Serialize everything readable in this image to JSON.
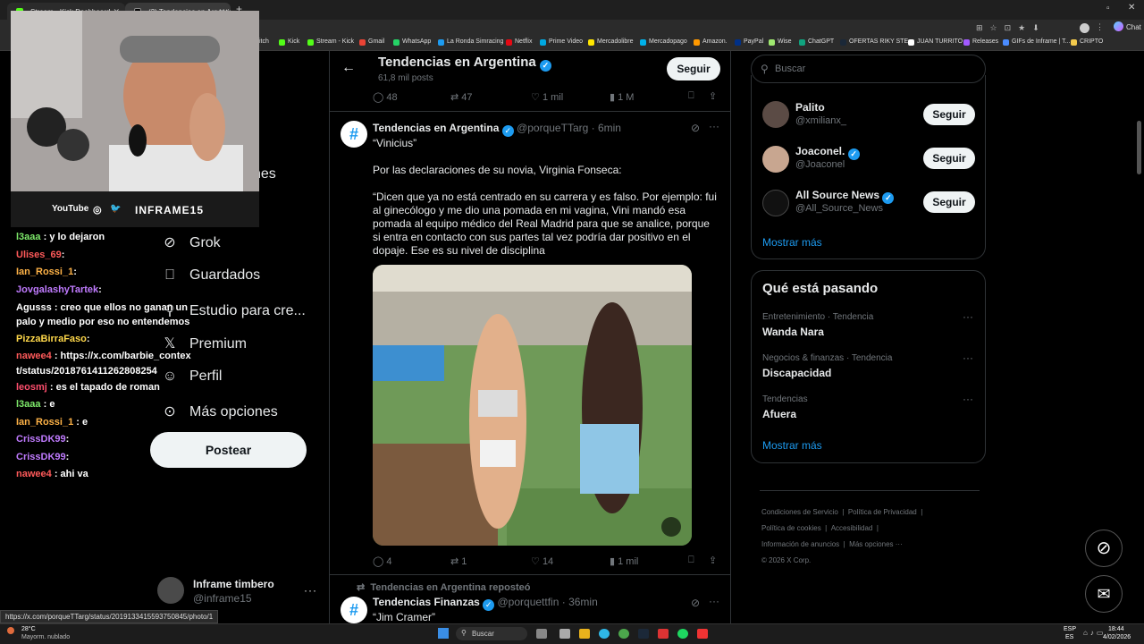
{
  "browser": {
    "tabs": [
      {
        "title": "Stream - Kick Dashboard"
      },
      {
        "title": "(2) Tendencias en Argentina (@po..."
      }
    ],
    "bookmarks": [
      "itch",
      "Kick",
      "Stream - Kick",
      "Gmail",
      "WhatsApp",
      "La Ronda Simracing",
      "Netflix",
      "Prime Video",
      "Mercadolibre",
      "Mercadopago",
      "Amazon.",
      "PayPal",
      "Wise",
      "ChatGPT",
      "OFERTAS RIKY STE...",
      "JUAN TURRITO",
      "Releases",
      "GIFs de Inframe | T...",
      "CRIPTO"
    ],
    "chat_btn": "Chat",
    "status_url": "https://x.com/porqueTTarg/status/2019133415593750845/photo/1"
  },
  "stream": {
    "social_youtube": "YouTube",
    "social_handle": "INFRAME15",
    "chat": [
      {
        "user": "l3aaa",
        "text": ": y lo dejaron",
        "color": "#7de86a"
      },
      {
        "user": "Ulises_69",
        "text": ":",
        "color": "#ff5a5a"
      },
      {
        "user": "Ian_Rossi_1",
        "text": ":",
        "color": "#ffb347"
      },
      {
        "user": "JovgalashyTartek",
        "text": ":",
        "color": "#c07bff"
      },
      {
        "user": "Agusss",
        "text": ": creo que ellos no ganan un palo y medio por eso no entendemos",
        "color": "#ffffff"
      },
      {
        "user": "PizzaBirraFaso",
        "text": ":",
        "color": "#ffd84a"
      },
      {
        "user": "nawee4",
        "text": ": https://x.com/barbie_context/status/2018761411262808254",
        "color": "#ff5a5a"
      },
      {
        "user": "leosmj",
        "text": ": es el tapado de roman",
        "color": "#ff4f6e"
      },
      {
        "user": "l3aaa",
        "text": ": e",
        "color": "#7de86a"
      },
      {
        "user": "Ian_Rossi_1",
        "text": ": e",
        "color": "#ffb347"
      },
      {
        "user": "CrissDK99",
        "text": ":",
        "color": "#c07bff"
      },
      {
        "user": "CrissDK99",
        "text": ":",
        "color": "#c07bff"
      },
      {
        "user": "nawee4",
        "text": ": ahi va",
        "color": "#ff5a5a"
      }
    ]
  },
  "nav": {
    "partial_item": "nes",
    "items": [
      "Grok",
      "Guardados",
      "Estudio para cre...",
      "Premium",
      "Perfil",
      "Más opciones"
    ],
    "post_button": "Postear",
    "account_name": "Inframe timbero",
    "account_handle": "@inframe15"
  },
  "header": {
    "title": "Tendencias en Argentina",
    "posts_count": "61,8 mil posts",
    "follow": "Seguir"
  },
  "top_stats": {
    "replies": "48",
    "retweets": "47",
    "likes": "1 mil",
    "views": "1 M"
  },
  "tweet": {
    "name": "Tendencias en Argentina",
    "handle": "@porqueTTarg",
    "time": "· 6min",
    "line1": "“Vinicius”",
    "line2": "Por las declaraciones de su novia, Virginia Fonseca:",
    "line3": "“Dicen que ya no está centrado en su carrera y es falso. Por ejemplo: fui al ginecólogo y me dio una pomada en mi vagina, Vini mandó esa pomada al equipo médico del Real Madrid para que se analice, porque si entra en contacto con sus partes tal vez podría dar positivo en el dopaje. Ese es su nivel de disciplina",
    "stats": {
      "replies": "4",
      "retweets": "1",
      "likes": "14",
      "views": "1 mil"
    }
  },
  "next_tweet": {
    "repost_label": "Tendencias en Argentina reposteó",
    "name": "Tendencias Finanzas",
    "handle": "@porquettfin",
    "time": "· 36min",
    "line1": "“Jim Cramer”"
  },
  "right": {
    "search_placeholder": "Buscar",
    "follow_suggestions": [
      {
        "name": "Palito",
        "handle": "@xmilianx_",
        "button": "Seguir",
        "verified": false
      },
      {
        "name": "Joaconel.",
        "handle": "@Joaconel",
        "button": "Seguir",
        "verified": true
      },
      {
        "name": "All Source News",
        "handle": "@All_Source_News",
        "button": "Seguir",
        "verified": true
      }
    ],
    "show_more_1": "Mostrar más",
    "trends_title": "Qué está pasando",
    "trends": [
      {
        "category": "Entretenimiento · Tendencia",
        "name": "Wanda Nara"
      },
      {
        "category": "Negocios & finanzas · Tendencia",
        "name": "Discapacidad"
      },
      {
        "category": "Tendencias",
        "name": "Afuera"
      }
    ],
    "show_more_2": "Mostrar más",
    "footer": [
      "Condiciones de Servicio",
      "|",
      "Política de Privacidad",
      "|",
      "Política de cookies",
      "|",
      "Accesibilidad",
      "|",
      "Información de anuncios",
      "|",
      "Más opciones ···",
      "© 2026 X Corp."
    ]
  },
  "taskbar": {
    "weather_temp": "28°C",
    "weather_desc": "Mayorm. nublado",
    "search": "Buscar",
    "lang": "ESP",
    "lang2": "ES",
    "time": "18:44",
    "date": "4/02/2026"
  }
}
